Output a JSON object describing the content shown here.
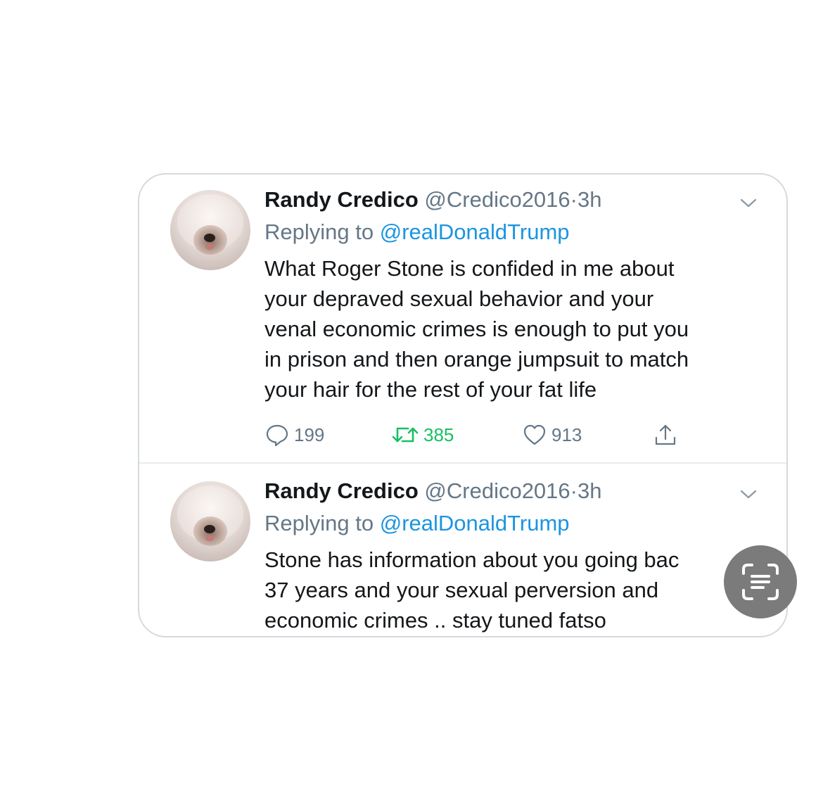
{
  "tweets": [
    {
      "display_name": "Randy Credico",
      "handle": "@Credico2016",
      "separator": "·",
      "time": "3h",
      "replying_prefix": "Replying to ",
      "replying_to": "@realDonaldTrump",
      "text": "What Roger Stone is confided in me  about\nyour depraved sexual behavior and your\nvenal economic crimes is enough to put you\nin prison and then orange jumpsuit to match\nyour hair for the rest of your fat life",
      "replies": "199",
      "retweets": "385",
      "likes": "913",
      "retweeted": true
    },
    {
      "display_name": "Randy Credico",
      "handle": "@Credico2016",
      "separator": "·",
      "time": "3h",
      "replying_prefix": "Replying to ",
      "replying_to": "@realDonaldTrump",
      "text": "Stone has information about you going bac\n37 years and your sexual perversion and\neconomic crimes .. stay tuned fatso"
    }
  ],
  "icons": {
    "reply": "reply-icon",
    "retweet": "retweet-icon",
    "like": "heart-icon",
    "share": "share-icon",
    "menu": "chevron-down-icon",
    "scan": "text-scan-icon"
  },
  "colors": {
    "text": "#14171a",
    "secondary": "#657786",
    "link": "#1b95e0",
    "retweet_active": "#17bf63",
    "border": "#d5d9dd",
    "scan_button": "#7b7b7b"
  }
}
